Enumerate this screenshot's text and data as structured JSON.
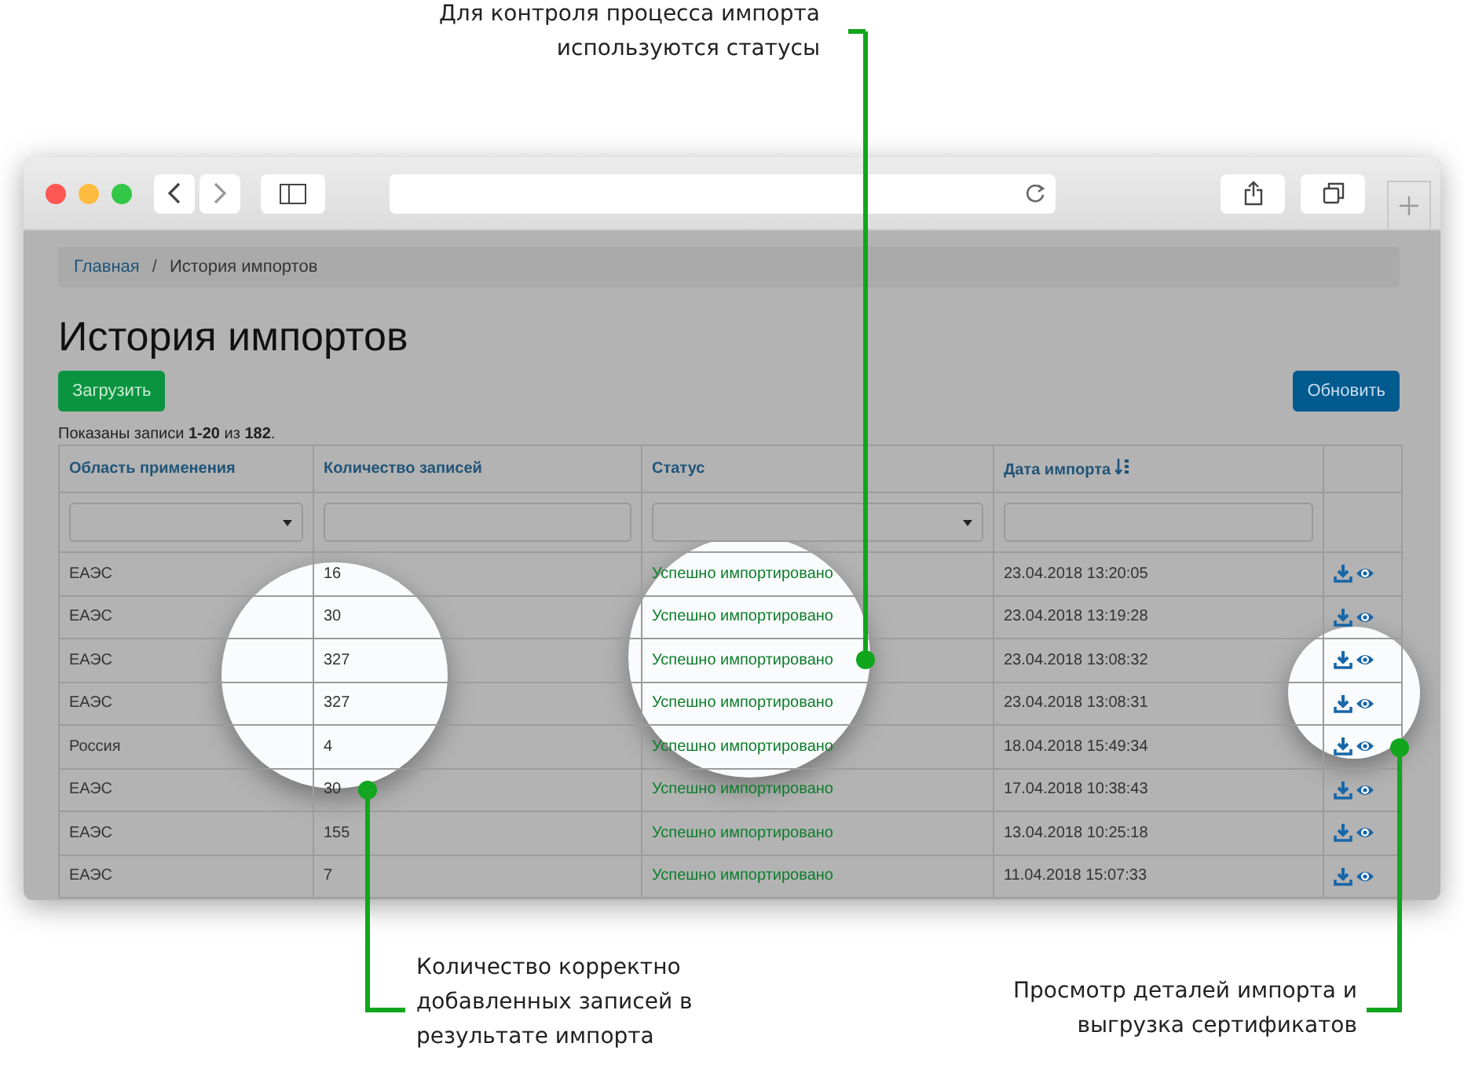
{
  "callouts": [
    {
      "lines": [
        "Для контроля процесса импорта",
        "используются статусы"
      ]
    },
    {
      "lines": [
        "Количество корректно",
        "добавленных записей в",
        "результате импорта"
      ]
    },
    {
      "lines": [
        "Просмотр деталей импорта и",
        "выгрузка сертификатов"
      ]
    }
  ],
  "breadcrumb": [
    {
      "label": "Главная",
      "link": true
    },
    {
      "label": "История импортов",
      "link": false
    }
  ],
  "breadcrumb_separator": "/",
  "title": "История импортов",
  "buttons": [
    {
      "label": "Загрузить",
      "kind": "success"
    },
    {
      "label": "Обновить",
      "kind": "primary"
    }
  ],
  "summary": "Показаны записи **1-20** из **182**.",
  "table": {
    "columns": [
      {
        "label": "Область применения",
        "kind": "select",
        "sorted": false
      },
      {
        "label": "Количество записей",
        "kind": "text",
        "sorted": false
      },
      {
        "label": "Статус",
        "kind": "select",
        "sorted": false
      },
      {
        "label": "Дата импорта",
        "kind": "text",
        "sorted": true
      },
      {
        "kind": "actions",
        "sorted": false
      }
    ],
    "rows": [
      [
        "ЕАЭС",
        "16",
        "Успешно импортировано",
        "23.04.2018 13:20:05"
      ],
      [
        "ЕАЭС",
        "30",
        "Успешно импортировано",
        "23.04.2018 13:19:28"
      ],
      [
        "ЕАЭС",
        "327",
        "Успешно импортировано",
        "23.04.2018 13:08:32"
      ],
      [
        "ЕАЭС",
        "327",
        "Успешно импортировано",
        "23.04.2018 13:08:31"
      ],
      [
        "Россия",
        "4",
        "Успешно импортировано",
        "18.04.2018 15:49:34"
      ],
      [
        "ЕАЭС",
        "30",
        "Успешно импортировано",
        "17.04.2018 10:38:43"
      ],
      [
        "ЕАЭС",
        "155",
        "Успешно импортировано",
        "13.04.2018 10:25:18"
      ],
      [
        "ЕАЭС",
        "7",
        "Успешно импортировано",
        "11.04.2018 15:07:33"
      ]
    ]
  }
}
